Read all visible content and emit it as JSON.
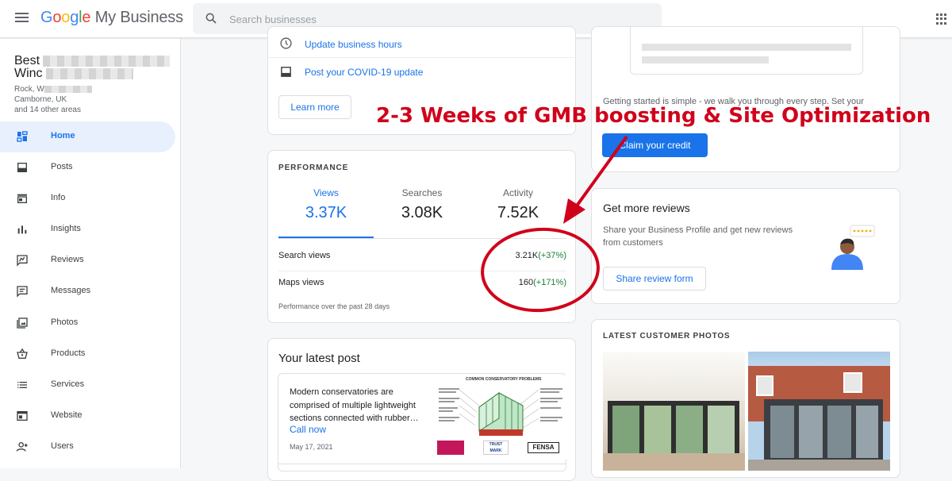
{
  "app": {
    "logo_google": "Google",
    "logo_rest": " My Business"
  },
  "search": {
    "placeholder": "Search businesses"
  },
  "business": {
    "name_line1": "Best",
    "name_line2": "Winc",
    "addr_line1": "Rock, W",
    "addr_line2": "Camborne, UK",
    "addr_line3": "and 14 other areas"
  },
  "nav": [
    {
      "label": "Home",
      "icon": "dashboard-icon",
      "active": true
    },
    {
      "label": "Posts",
      "icon": "posts-icon"
    },
    {
      "label": "Info",
      "icon": "store-icon"
    },
    {
      "label": "Insights",
      "icon": "bar-chart-icon"
    },
    {
      "label": "Reviews",
      "icon": "reviews-icon"
    },
    {
      "label": "Messages",
      "icon": "message-icon"
    },
    {
      "label": "Photos",
      "icon": "photos-icon"
    },
    {
      "label": "Products",
      "icon": "basket-icon"
    },
    {
      "label": "Services",
      "icon": "list-icon"
    },
    {
      "label": "Website",
      "icon": "website-icon"
    },
    {
      "label": "Users",
      "icon": "add-user-icon"
    }
  ],
  "updates": {
    "hours_link": "Update business hours",
    "covid_link": "Post your COVID-19 update",
    "learn_more": "Learn more"
  },
  "performance": {
    "title": "PERFORMANCE",
    "tabs": [
      {
        "label": "Views",
        "value": "3.37K"
      },
      {
        "label": "Searches",
        "value": "3.08K"
      },
      {
        "label": "Activity",
        "value": "7.52K"
      }
    ],
    "rows": [
      {
        "label": "Search views",
        "value": "3.21K",
        "change": "(+37%)"
      },
      {
        "label": "Maps views",
        "value": "160",
        "change": "(+171%)"
      }
    ],
    "footnote": "Performance over the past 28 days"
  },
  "latest_post": {
    "title": "Your latest post",
    "text": "Modern conservatories are comprised of multiple lightweight sections connected with rubber…",
    "cta": "Call now",
    "date": "May 17, 2021",
    "image_caption": "COMMON CONSERVATORY PROBLEMS",
    "badge_labels": [
      "TRUST MARK",
      "FENSA"
    ]
  },
  "credit": {
    "text": "Getting started is simple - we walk you through every step. Set your",
    "button": "Claim your credit"
  },
  "reviews": {
    "title": "Get more reviews",
    "text": "Share your Business Profile and get new reviews from customers",
    "button": "Share review form"
  },
  "photos": {
    "title": "LATEST CUSTOMER PHOTOS"
  },
  "annotation": {
    "text": "2-3 Weeks of GMB boosting & Site Optimization",
    "color": "#d0021b"
  },
  "colors": {
    "accent": "#1a73e8",
    "positive": "#188038",
    "annotation": "#d0021b"
  }
}
